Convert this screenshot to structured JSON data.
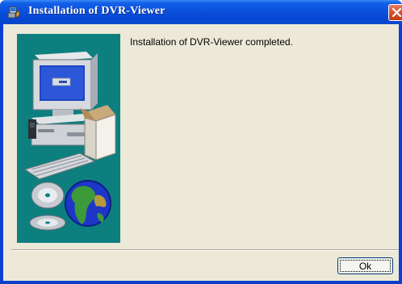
{
  "window": {
    "title": "Installation of DVR-Viewer",
    "icons": {
      "app": "installer-icon",
      "close": "close-icon"
    }
  },
  "content": {
    "message": "Installation of DVR-Viewer completed.",
    "illustration": "computer-and-globe-illustration"
  },
  "buttons": {
    "ok_label": "Ok"
  },
  "colors": {
    "titlebar": "#0a4fdb",
    "client_bg": "#ece9d8",
    "side_panel": "#0d7f7f",
    "close_button": "#d9512c"
  }
}
